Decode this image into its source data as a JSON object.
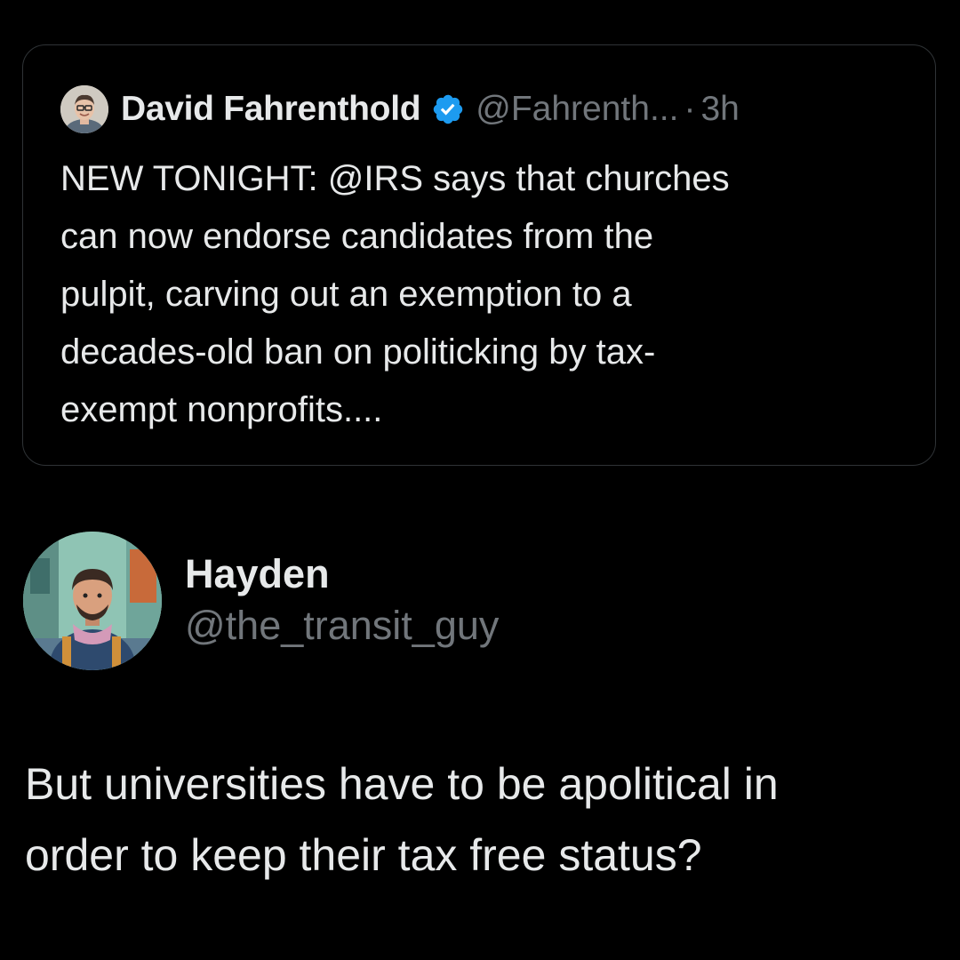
{
  "quoted_tweet": {
    "author_name": "David Fahrenthold",
    "author_handle": "@Fahrenth...",
    "separator": "·",
    "time": "3h",
    "verified": true,
    "text": "NEW TONIGHT: @IRS says that churches\ncan now endorse candidates from the\npulpit, carving out an exemption to a\ndecades-old ban on politicking by tax-\nexempt nonprofits...."
  },
  "reply_tweet": {
    "author_name": "Hayden",
    "author_handle": "@the_transit_guy",
    "text": "But universities have to be apolitical in\norder to keep their tax free status?"
  },
  "colors": {
    "background": "#000000",
    "text_primary": "#e7e9ea",
    "text_secondary": "#71767b",
    "border": "#2f3336",
    "verified_blue": "#1d9bf0"
  },
  "icons": {
    "verified": "verified-badge-icon",
    "avatar_small": "avatar",
    "avatar_large": "avatar"
  }
}
